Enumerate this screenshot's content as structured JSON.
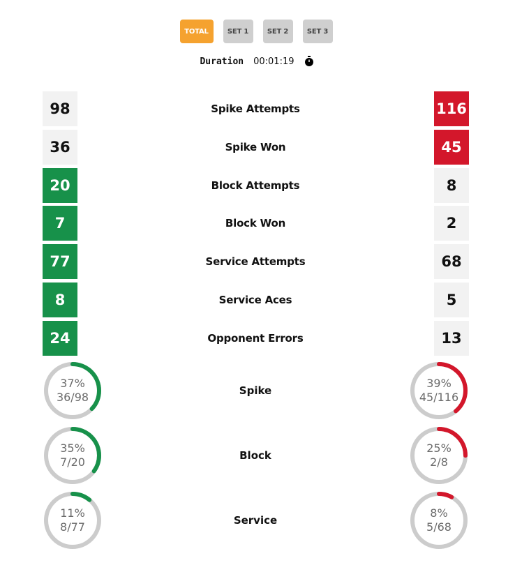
{
  "tabs": [
    {
      "label": "TOTAL",
      "active": true
    },
    {
      "label": "SET 1",
      "active": false
    },
    {
      "label": "SET 2",
      "active": false
    },
    {
      "label": "SET 3",
      "active": false
    }
  ],
  "duration": {
    "label": "Duration",
    "value": "00:01:19",
    "icon": "stopwatch-icon"
  },
  "colors": {
    "green": "#17914a",
    "red": "#d3172b",
    "neutral": "#f2f2f2",
    "ring_track": "#cccccc",
    "active_tab": "#f5a22f"
  },
  "stats": [
    {
      "label": "Spike Attempts",
      "left": "98",
      "right": "116",
      "highlight": "right"
    },
    {
      "label": "Spike Won",
      "left": "36",
      "right": "45",
      "highlight": "right"
    },
    {
      "label": "Block Attempts",
      "left": "20",
      "right": "8",
      "highlight": "left"
    },
    {
      "label": "Block Won",
      "left": "7",
      "right": "2",
      "highlight": "left"
    },
    {
      "label": "Service Attempts",
      "left": "77",
      "right": "68",
      "highlight": "left"
    },
    {
      "label": "Service Aces",
      "left": "8",
      "right": "5",
      "highlight": "left"
    },
    {
      "label": "Opponent Errors",
      "left": "24",
      "right": "13",
      "highlight": "left"
    }
  ],
  "efficiency": [
    {
      "label": "Spike",
      "left": {
        "percent": "37%",
        "ratio": "36/98",
        "fraction": 0.37
      },
      "right": {
        "percent": "39%",
        "ratio": "45/116",
        "fraction": 0.39
      }
    },
    {
      "label": "Block",
      "left": {
        "percent": "35%",
        "ratio": "7/20",
        "fraction": 0.35
      },
      "right": {
        "percent": "25%",
        "ratio": "2/8",
        "fraction": 0.25
      }
    },
    {
      "label": "Service",
      "left": {
        "percent": "11%",
        "ratio": "8/77",
        "fraction": 0.11
      },
      "right": {
        "percent": "8%",
        "ratio": "5/68",
        "fraction": 0.08
      }
    }
  ]
}
